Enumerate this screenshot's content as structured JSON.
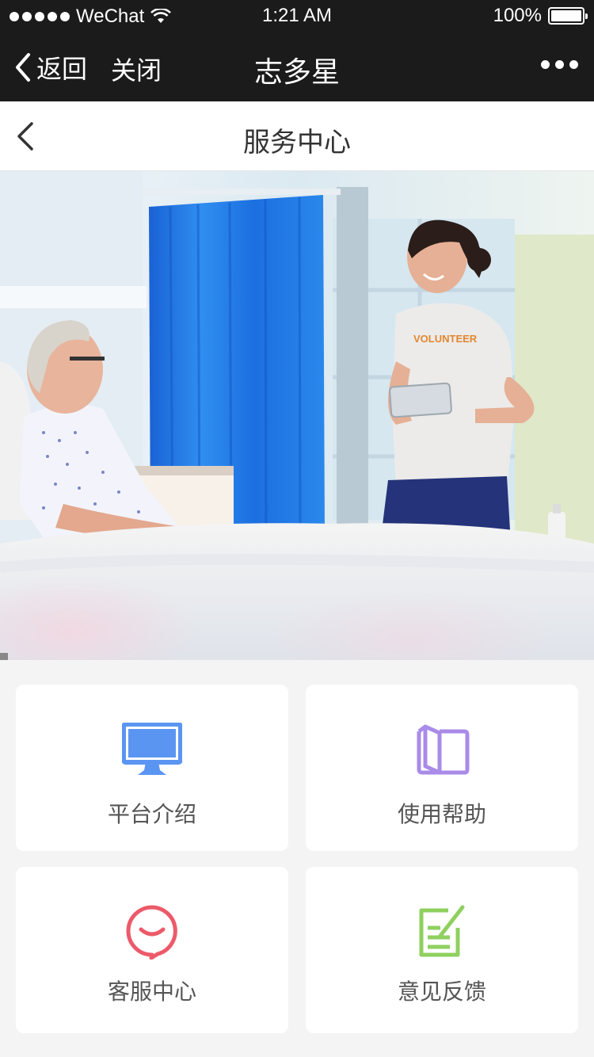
{
  "status_bar": {
    "carrier": "WeChat",
    "time": "1:21 AM",
    "battery": "100%",
    "battery_level": 1.0
  },
  "wechat_nav": {
    "back_label": "返回",
    "close_label": "关闭",
    "title": "志多星"
  },
  "page": {
    "title": "服务中心"
  },
  "hero": {
    "shirt_text": "VOLUNTEER"
  },
  "services": [
    {
      "label": "平台介绍",
      "icon": "monitor-icon",
      "color": "#5b95f2"
    },
    {
      "label": "使用帮助",
      "icon": "book-icon",
      "color": "#a98be8"
    },
    {
      "label": "客服中心",
      "icon": "chat-smile-icon",
      "color": "#ec5a6a"
    },
    {
      "label": "意见反馈",
      "icon": "edit-note-icon",
      "color": "#8fd05f"
    }
  ]
}
